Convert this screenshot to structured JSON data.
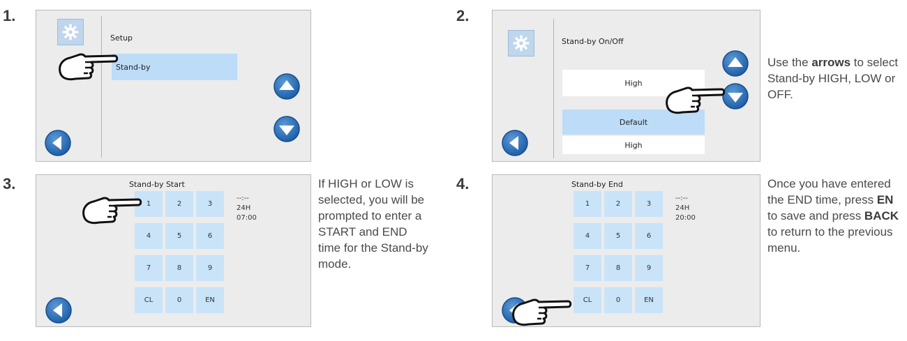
{
  "steps": [
    {
      "num": "1.",
      "heading": "Setup",
      "item": "Stand-by"
    },
    {
      "num": "2.",
      "heading": "Stand-by On/Off",
      "value": "High",
      "default_label": "Default",
      "default_value": "High"
    },
    {
      "num": "3.",
      "heading": "Stand-by Start",
      "display": {
        "line1": "--:--",
        "line2": "24H",
        "line3": "07:00"
      }
    },
    {
      "num": "4.",
      "heading": "Stand-by End",
      "display": {
        "line1": "--:--",
        "line2": "24H",
        "line3": "20:00"
      }
    }
  ],
  "keypad": [
    "1",
    "2",
    "3",
    "4",
    "5",
    "6",
    "7",
    "8",
    "9",
    "CL",
    "0",
    "EN"
  ],
  "descriptions": {
    "step2": {
      "a": "Use the ",
      "b": "arrows",
      "c": " to select Stand-by HIGH, LOW or OFF."
    },
    "step3": "If HIGH or LOW is selected, you will be prompted to enter a START and END time for the Stand-by mode.",
    "step4": {
      "a": "Once you have entered the END time, press ",
      "b": "EN",
      "c": " to save and press ",
      "d": "BACK",
      "e": " to return to the previous menu."
    }
  },
  "icons": [
    "gear-icon",
    "arrow-up-icon",
    "arrow-down-icon",
    "back-arrow-icon",
    "pointing-hand-icon"
  ],
  "colors": {
    "accent": "#2a6fb6",
    "highlight": "#bcdcf7",
    "key": "#c9e3f8",
    "screen": "#ececec"
  }
}
